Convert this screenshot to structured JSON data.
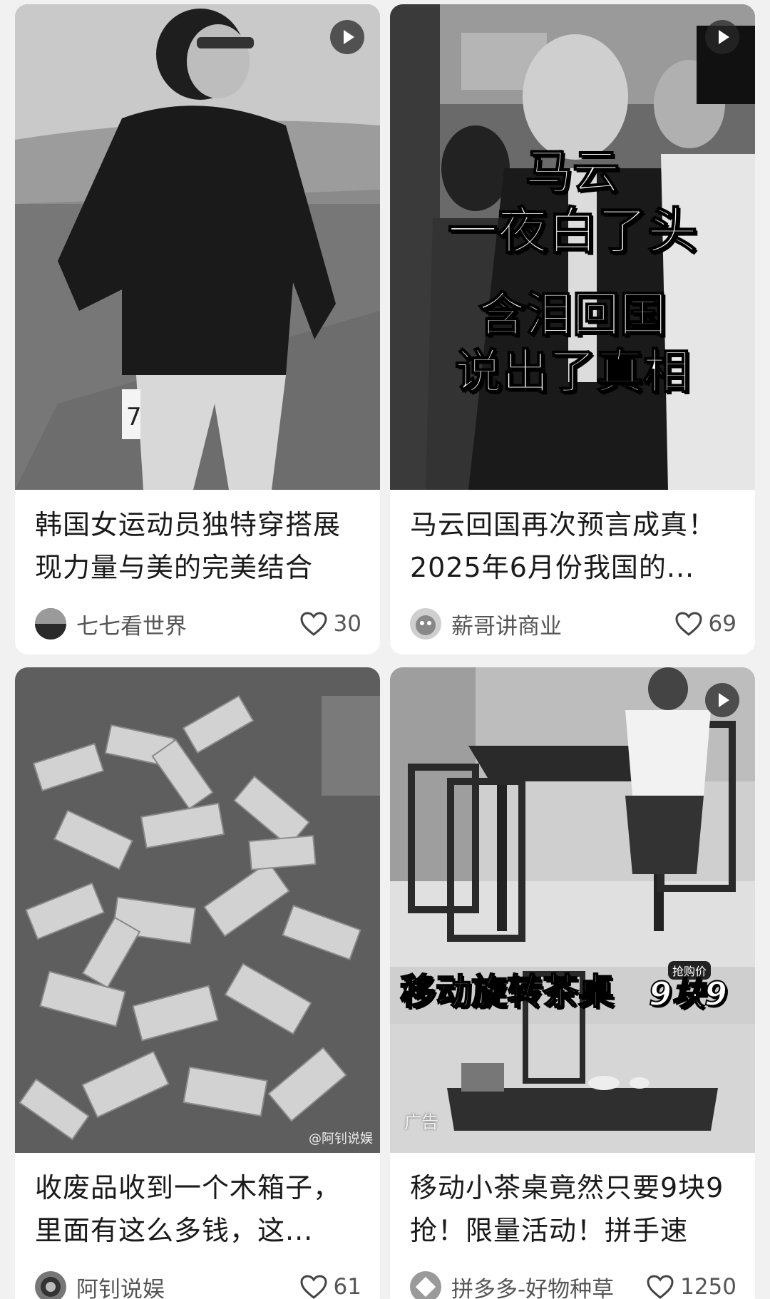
{
  "cards": [
    {
      "title": "韩国女运动员独特穿搭展现力量与美的完美结合",
      "author": "七七看世界",
      "likes": "30",
      "has_video": true,
      "image": "athlete-photo"
    },
    {
      "title": "马云回国再次预言成真！2025年6月份我国的...",
      "author": "薪哥讲商业",
      "likes": "69",
      "has_video": true,
      "image": "news-photo",
      "overlay": {
        "line1": "马云",
        "line2": "一夜白了头",
        "line3": "含泪回国",
        "line4": "说出了真相"
      }
    },
    {
      "title": "收废品收到一个木箱子，里面有这么多钱，这...",
      "author": "阿钊说娱",
      "likes": "61",
      "has_video": false,
      "image": "money-pile-photo",
      "watermark": "@阿钊说娱"
    },
    {
      "title": "移动小茶桌竟然只要9块9抢！限量活动！拼手速",
      "author": "拼多多-好物种草",
      "likes": "1250",
      "has_video": true,
      "image": "tea-table-photo",
      "ad_label": "广告",
      "banner": "移动旋转茶桌",
      "price_tag": "抢购价",
      "price": "9块9"
    }
  ],
  "icons": {
    "play": "play-icon",
    "like": "heart-icon"
  },
  "colors": {
    "background": "#f1f1f1",
    "card": "#ffffff",
    "text": "#1a1a1a",
    "muted": "#555555"
  }
}
